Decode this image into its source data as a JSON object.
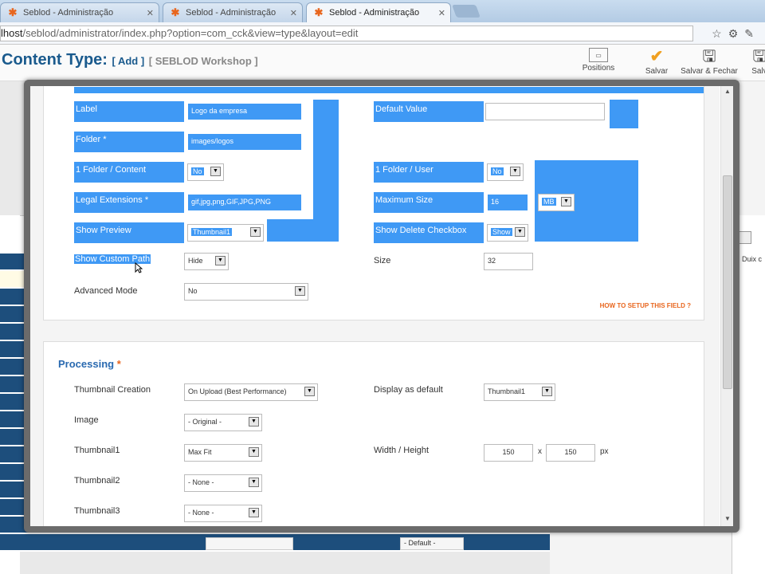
{
  "browser": {
    "tabs": [
      {
        "title": "Seblod - Administração"
      },
      {
        "title": "Seblod - Administração"
      },
      {
        "title": "Seblod - Administração"
      }
    ],
    "url_prefix": "lhost",
    "url_rest": "/seblod/administrator/index.php?option=com_cck&view=type&layout=edit"
  },
  "toolbar": {
    "title": "Content Type:",
    "action": "[ Add ]",
    "context": "[ SEBLOD Workshop ]",
    "positions_label": "Positions",
    "save_label": "Salvar",
    "save_close_label": "Salvar & Fechar",
    "save_new_label": "Salv"
  },
  "colors": {
    "selection": "#3f99f5",
    "title_blue": "#1a5a8d",
    "accent_orange": "#e8661e",
    "bg_row_blue": "#1d4e7c"
  },
  "construction": {
    "label_label": "Label",
    "label_value": "Logo da empresa",
    "default_value_label": "Default Value",
    "default_value": "",
    "folder_label": "Folder *",
    "folder_value": "images/logos",
    "folder_content_label": "1 Folder / Content",
    "folder_content_value": "No",
    "folder_user_label": "1 Folder / User",
    "folder_user_value": "No",
    "legal_ext_label": "Legal Extensions *",
    "legal_ext_value": "gif,jpg,png,GIF,JPG,PNG",
    "max_size_label": "Maximum Size",
    "max_size_value": "16",
    "max_size_unit": "MB",
    "show_preview_label": "Show Preview",
    "show_preview_value": "Thumbnail1",
    "show_delete_label": "Show Delete Checkbox",
    "show_delete_value": "Show",
    "show_custom_path_label": "Show Custom Path",
    "show_custom_path_value": "Hide",
    "size_label": "Size",
    "size_value": "32",
    "advanced_mode_label": "Advanced Mode",
    "advanced_mode_value": "No",
    "howto": "HOW TO SETUP THIS FIELD ?"
  },
  "processing": {
    "title": "Processing",
    "required_mark": "*",
    "thumb_creation_label": "Thumbnail Creation",
    "thumb_creation_value": "On Upload (Best Performance)",
    "display_default_label": "Display as default",
    "display_default_value": "Thumbnail1",
    "image_label": "Image",
    "image_value": "- Original -",
    "thumb1_label": "Thumbnail1",
    "thumb1_value": "Max Fit",
    "width_height_label": "Width / Height",
    "width_value": "150",
    "height_value": "150",
    "times": "x",
    "px": "px",
    "thumb2_label": "Thumbnail2",
    "thumb2_value": "- None -",
    "thumb3_label": "Thumbnail3",
    "thumb3_value": "- None -"
  },
  "background": {
    "default_select": "- Default -",
    "side_label": "Duix c"
  }
}
